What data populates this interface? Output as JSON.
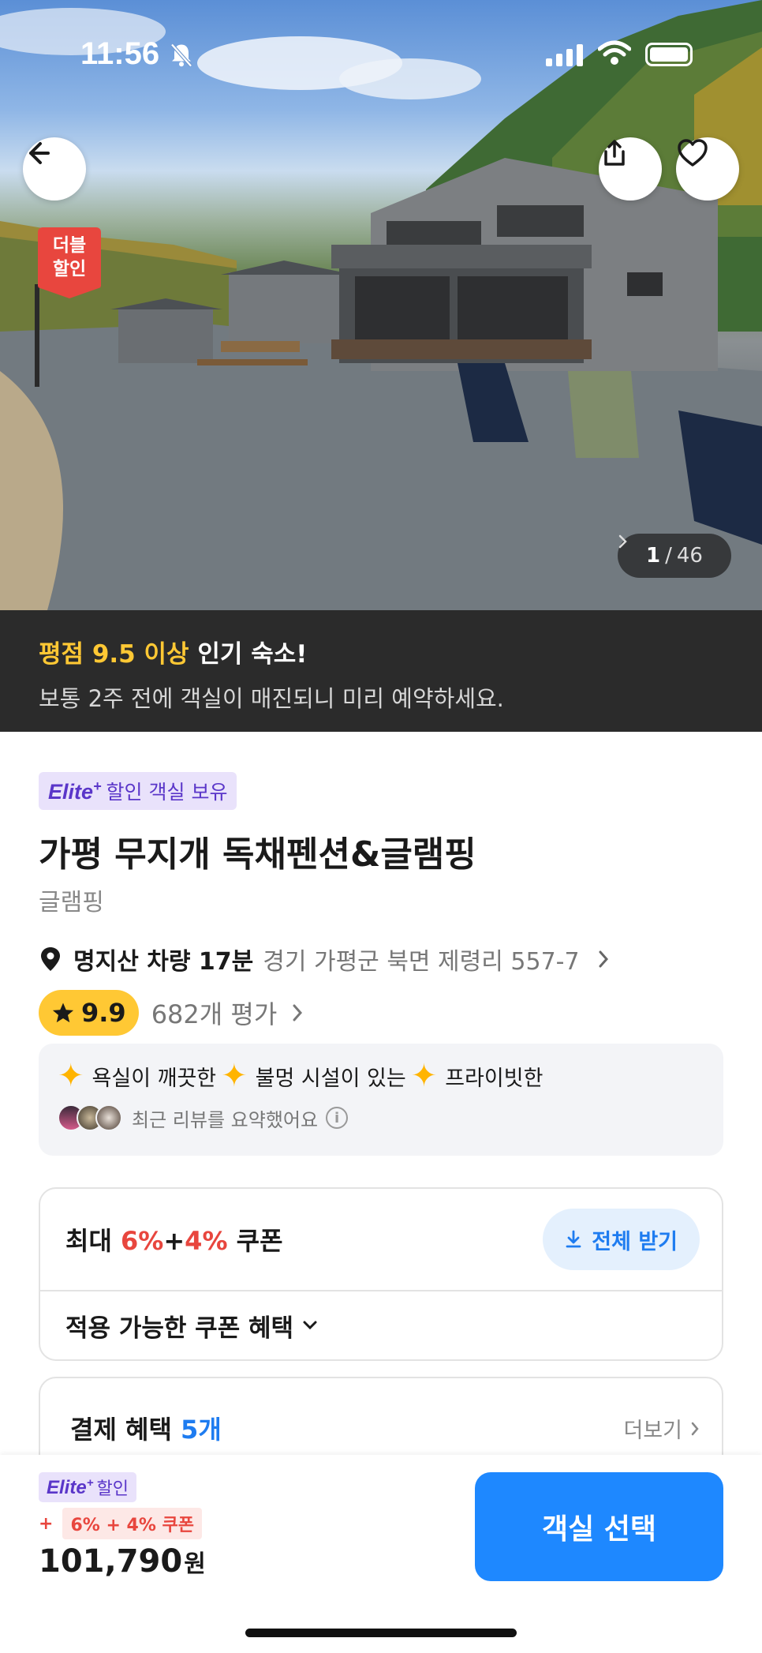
{
  "status_bar": {
    "time": "11:56"
  },
  "hero": {
    "badge_line1": "더블",
    "badge_line2": "할인",
    "photo_current": "1",
    "photo_separator": "/",
    "photo_total": "46"
  },
  "popular_banner": {
    "highlight": "평점 9.5 이상",
    "title_rest": " 인기 숙소!",
    "subtitle": "보통 2주 전에 객실이 매진되니 미리 예약하세요."
  },
  "property": {
    "elite_brand": "Elite",
    "elite_plus": "+",
    "elite_tag_text": "할인 객실 보유",
    "name": "가평 무지개 독채펜션&글램핑",
    "category": "글램핑",
    "landmark": "명지산 차량 17분",
    "address": "경기 가평군 북면 제령리 557-7",
    "rating": "9.9",
    "review_count": "682개 평가"
  },
  "review_summary": {
    "keywords": [
      "욕실이 깨끗한",
      "불멍 시설이 있는",
      "프라이빗한"
    ],
    "summary_text": "최근 리뷰를 요약했어요",
    "info_icon": "i"
  },
  "coupon": {
    "prefix": "최대 ",
    "pct1": "6%",
    "plus": "+",
    "pct2": "4%",
    "suffix": " 쿠폰",
    "get_all_label": "전체 받기",
    "benefits_label": "적용 가능한 쿠폰 혜택"
  },
  "payment": {
    "label": "결제 혜택 ",
    "count": "5개",
    "more_label": "더보기"
  },
  "bottom_bar": {
    "elite_brand": "Elite",
    "elite_plus": "+",
    "elite_label": "할인",
    "coupon_plus": "+",
    "coupon_chip": "6% + 4% 쿠폰",
    "price": "101,790",
    "currency": "원",
    "select_label": "객실 선택"
  },
  "colors": {
    "accent_blue": "#1e88ff",
    "rating_yellow": "#ffc834",
    "discount_red": "#e8463e",
    "elite_purple": "#5a36c9"
  }
}
